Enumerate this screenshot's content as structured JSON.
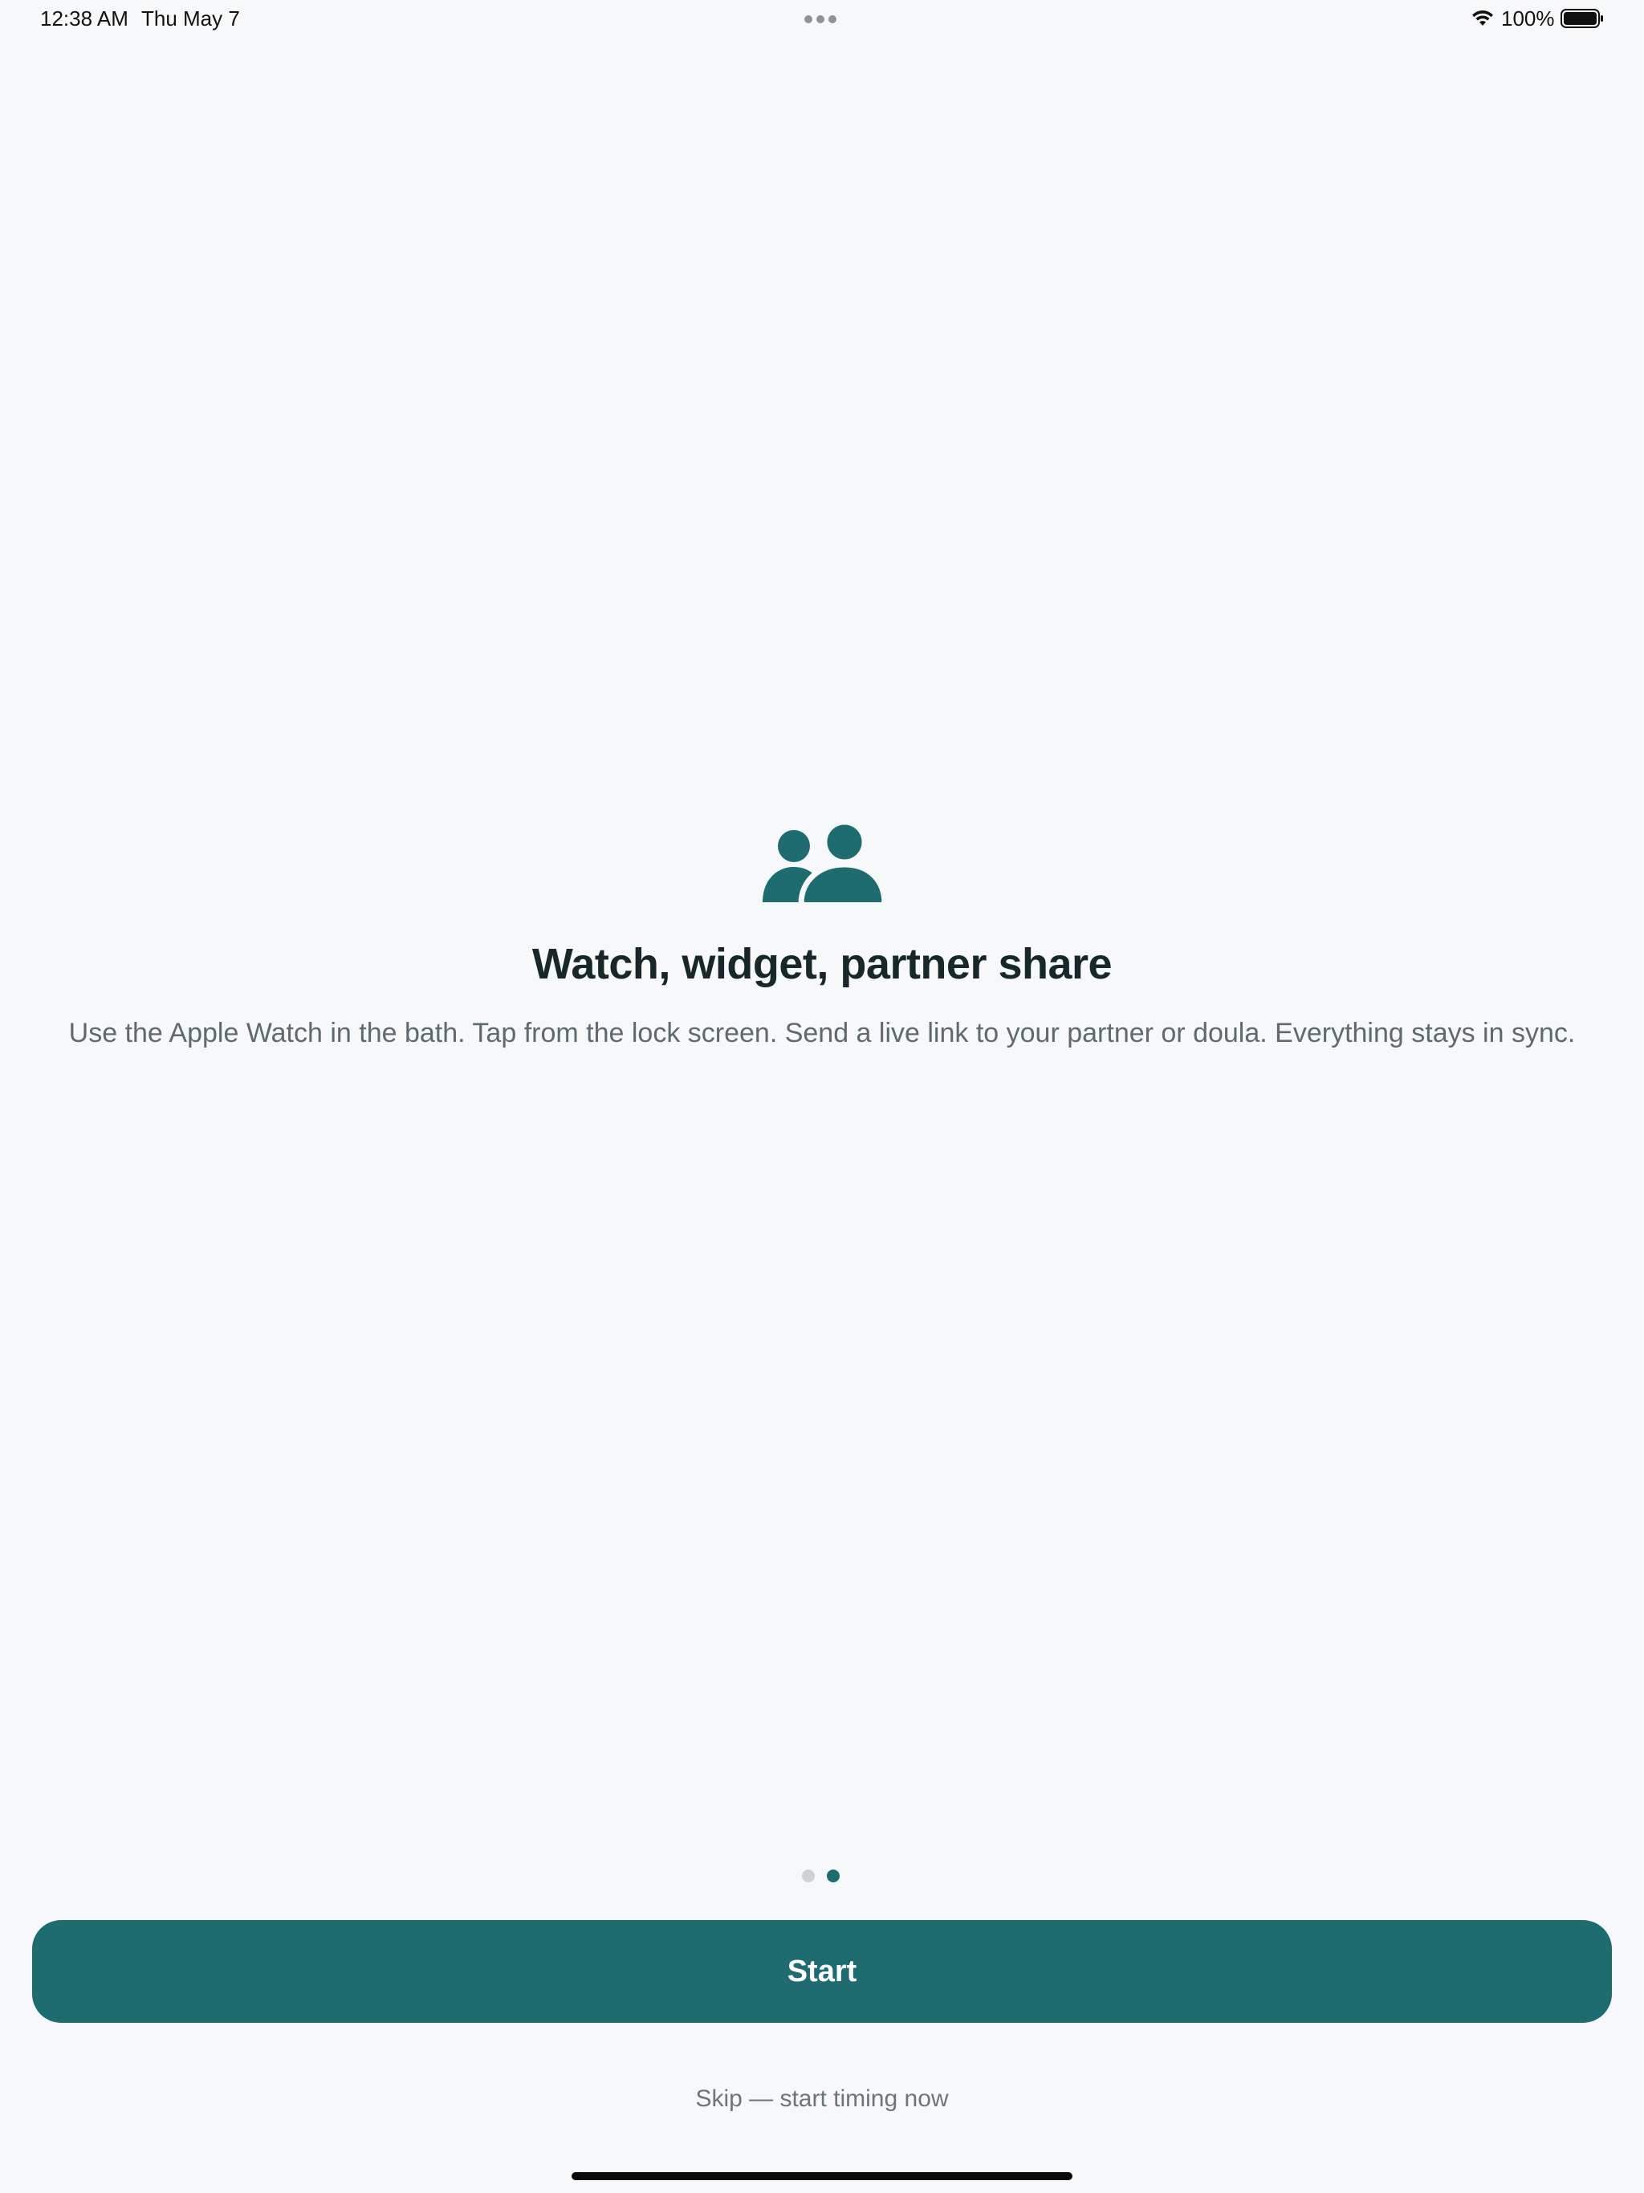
{
  "status_bar": {
    "time": "12:38 AM",
    "date": "Thu May 7",
    "battery_percent": "100%",
    "battery_level": 1.0,
    "icons": [
      "wifi-icon",
      "battery-icon",
      "multitask-dots-icon"
    ]
  },
  "onboarding": {
    "icon": "people-icon",
    "headline": "Watch, widget, partner share",
    "subtitle": "Use the Apple Watch in the bath. Tap from the lock screen. Send a live link to your partner or doula. Everything stays in sync.",
    "page_count": 2,
    "current_page": 2
  },
  "actions": {
    "start_label": "Start",
    "skip_label": "Skip — start timing now"
  },
  "colors": {
    "accent": "#1e6b70",
    "background": "#f6f8fa",
    "headline": "#18272a",
    "subtitle": "#5e6a70",
    "dot_inactive": "#cdd2d4"
  }
}
